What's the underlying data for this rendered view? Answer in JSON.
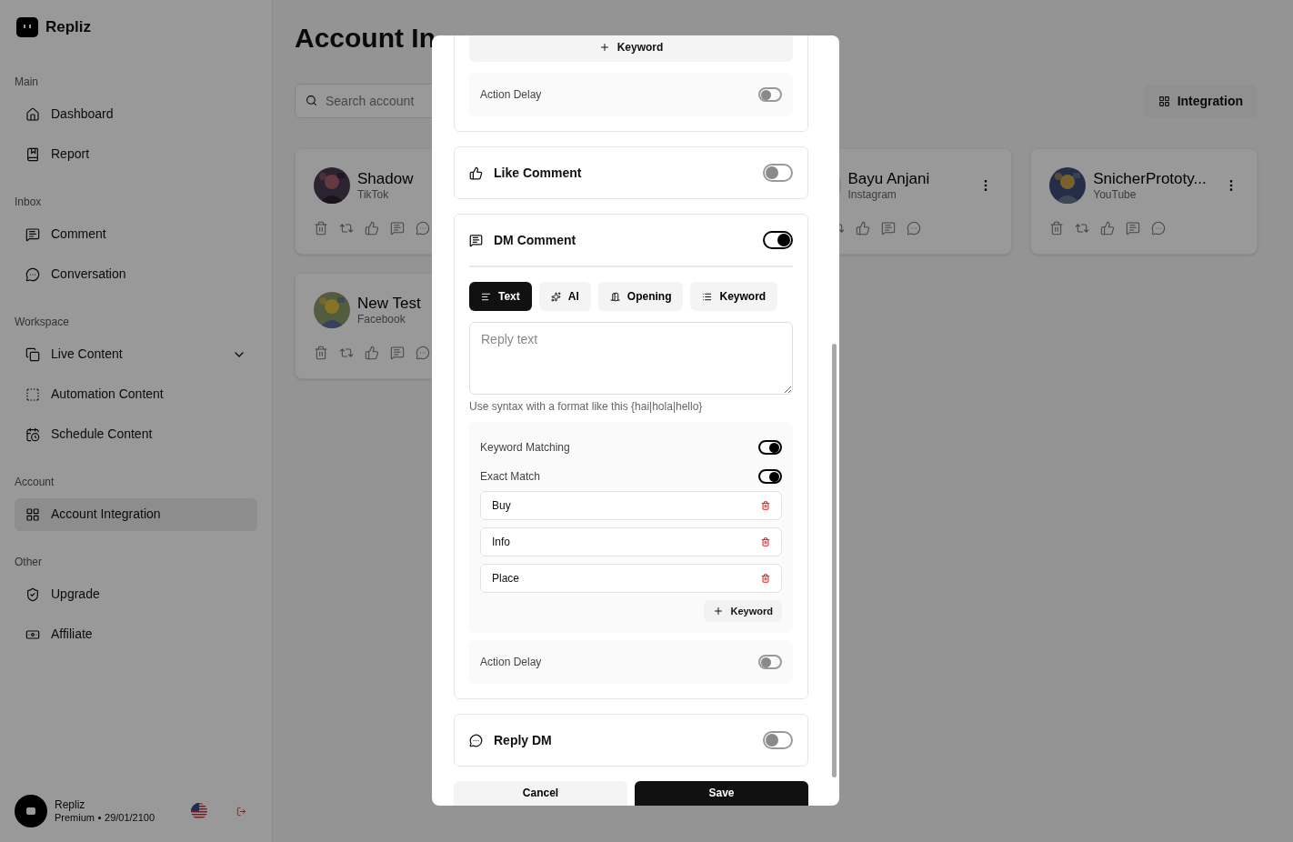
{
  "sidebar": {
    "brand": "Repliz",
    "sections": [
      {
        "title": "Main",
        "items": [
          {
            "label": "Dashboard",
            "selected": false
          },
          {
            "label": "Report",
            "selected": false
          }
        ]
      },
      {
        "title": "Inbox",
        "items": [
          {
            "label": "Comment",
            "selected": false
          },
          {
            "label": "Conversation",
            "selected": false
          }
        ]
      },
      {
        "title": "Workspace",
        "items": [
          {
            "label": "Live Content",
            "selected": false,
            "expanded": false
          },
          {
            "label": "Automation Content",
            "selected": false
          },
          {
            "label": "Schedule Content",
            "selected": false
          }
        ]
      },
      {
        "title": "Account",
        "items": [
          {
            "label": "Account Integration",
            "selected": true
          }
        ]
      },
      {
        "title": "Other",
        "items": [
          {
            "label": "Upgrade",
            "selected": false
          },
          {
            "label": "Affiliate",
            "selected": false
          }
        ]
      }
    ],
    "user": {
      "name": "Repliz",
      "plan": "Premium",
      "expiry": "29/01/2100"
    }
  },
  "page": {
    "title": "Account In",
    "search": {
      "placeholder": "Search account"
    },
    "integration_button": "Integration",
    "accounts": [
      {
        "name": "Shadow",
        "platform": "TikTok"
      },
      {
        "name": "Bayu Anjani",
        "platform": "Instagram",
        "menu": true
      },
      {
        "name": "SnicherPrototy...",
        "platform": "YouTube",
        "menu": true
      },
      {
        "name": "New Test",
        "platform": "Facebook"
      }
    ]
  },
  "modal": {
    "top": {
      "add_keyword": "Keyword",
      "action_delay": {
        "label": "Action Delay",
        "on": false
      }
    },
    "sections": [
      {
        "kind": "toggle",
        "title": "Like Comment",
        "on": false
      },
      {
        "kind": "dm",
        "title": "DM Comment",
        "on": true,
        "tabs": [
          {
            "label": "Text",
            "selected": true
          },
          {
            "label": "AI",
            "selected": false
          },
          {
            "label": "Opening",
            "selected": false
          },
          {
            "label": "Keyword",
            "selected": false
          }
        ],
        "reply": {
          "placeholder": "Reply text"
        },
        "hint": "Use syntax with a format like this {hai|hola|hello}",
        "keyword_matching": {
          "label": "Keyword Matching",
          "on": true
        },
        "exact_match": {
          "label": "Exact Match",
          "on": true
        },
        "keywords": [
          "Buy",
          "Info",
          "Place"
        ],
        "add_keyword": "Keyword",
        "action_delay": {
          "label": "Action Delay",
          "on": false
        }
      },
      {
        "kind": "toggle",
        "title": "Reply DM",
        "on": false
      }
    ],
    "buttons": [
      {
        "label": "Cancel",
        "kind": "secondary"
      },
      {
        "label": "Save",
        "kind": "primary"
      }
    ]
  }
}
